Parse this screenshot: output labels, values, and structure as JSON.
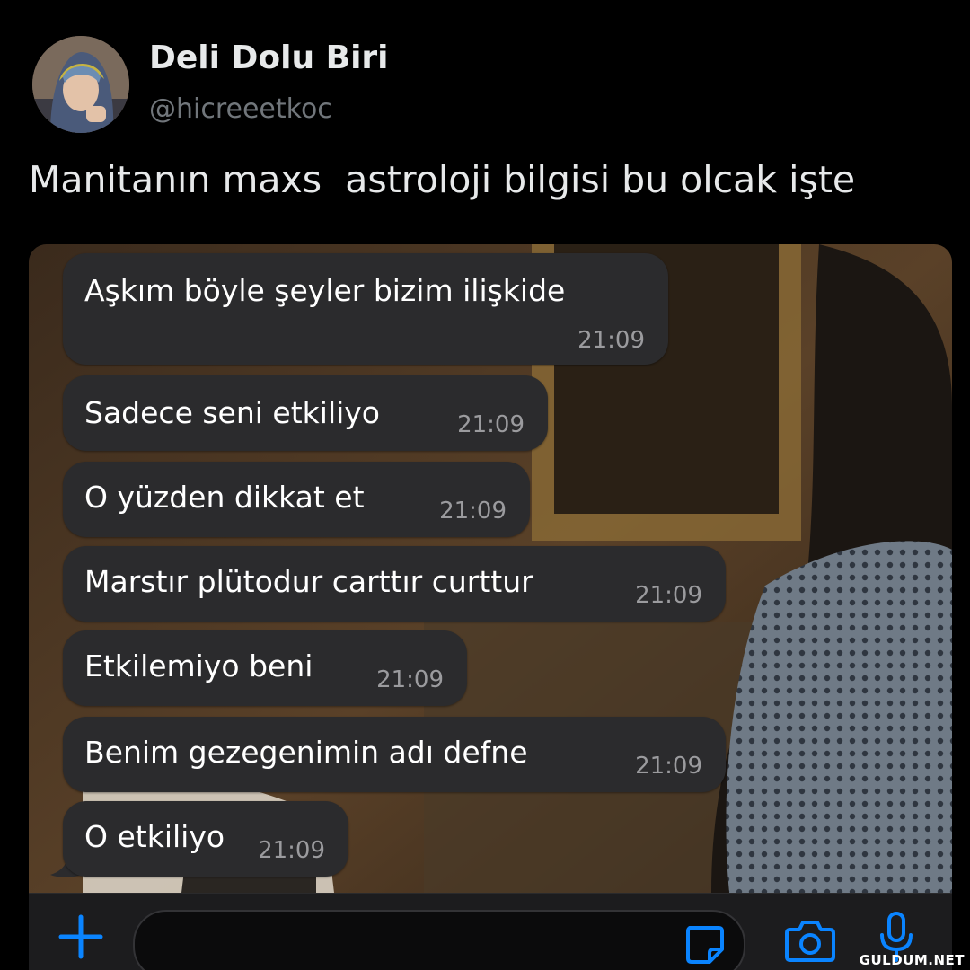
{
  "tweet": {
    "display_name": "Deli Dolu Biri",
    "handle": "@hicreeetkoc",
    "text": "Manitanın maxs  astroloji bilgisi bu olcak işte"
  },
  "chat": {
    "messages": [
      {
        "text": "Aşkım böyle şeyler bizim ilişkide",
        "time": "21:09"
      },
      {
        "text": "Sadece seni etkiliyo",
        "time": "21:09"
      },
      {
        "text": "O yüzden dikkat et",
        "time": "21:09"
      },
      {
        "text": "Marstır plütodur carttır curttur",
        "time": "21:09"
      },
      {
        "text": "Etkilemiyo beni",
        "time": "21:09"
      },
      {
        "text": "Benim gezegenimin adı defne",
        "time": "21:09"
      },
      {
        "text": "O etkiliyo",
        "time": "21:09"
      }
    ],
    "icons": [
      "plus-icon",
      "sticker-icon",
      "camera-icon",
      "microphone-icon"
    ],
    "accent_color": "#0a84ff"
  },
  "watermark": "GULDUM.NET"
}
